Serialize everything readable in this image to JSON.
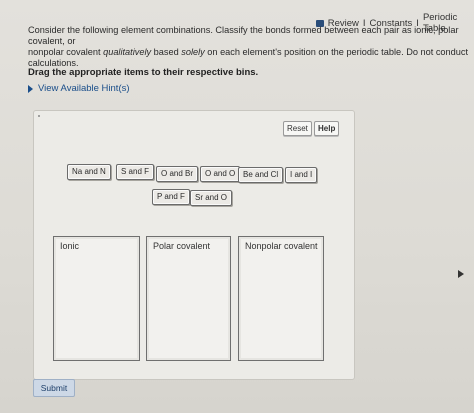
{
  "header": {
    "review_label": "Review",
    "constants_label": "Constants",
    "periodic_label": "Periodic Table",
    "sep": "I"
  },
  "prompt": {
    "line1": "Consider the following element combinations. Classify the bonds formed between each pair as ionic, polar covalent, or",
    "line2_a": "nonpolar covalent ",
    "line2_italic1": "qualitatively",
    "line2_b": " based ",
    "line2_italic2": "solely",
    "line2_c": " on each element's position on the periodic table. Do not conduct",
    "line3": "calculations."
  },
  "instruction": "Drag the appropriate items to their respective bins.",
  "hints_label": "View Available Hint(s)",
  "buttons": {
    "reset": "Reset",
    "help": "Help",
    "submit": "Submit"
  },
  "items": [
    "Na and N",
    "S and F",
    "O and Br",
    "O and O",
    "Be and Cl",
    "I and I",
    "P and F",
    "Sr and O"
  ],
  "bins": [
    "Ionic",
    "Polar covalent",
    "Nonpolar covalent"
  ],
  "icons": {
    "review": "book-icon",
    "hints": "caret-right-icon",
    "cursor": "mouse-cursor-icon"
  },
  "colors": {
    "link": "#1a4e8a",
    "submit_bg": "#cdd8e6"
  }
}
